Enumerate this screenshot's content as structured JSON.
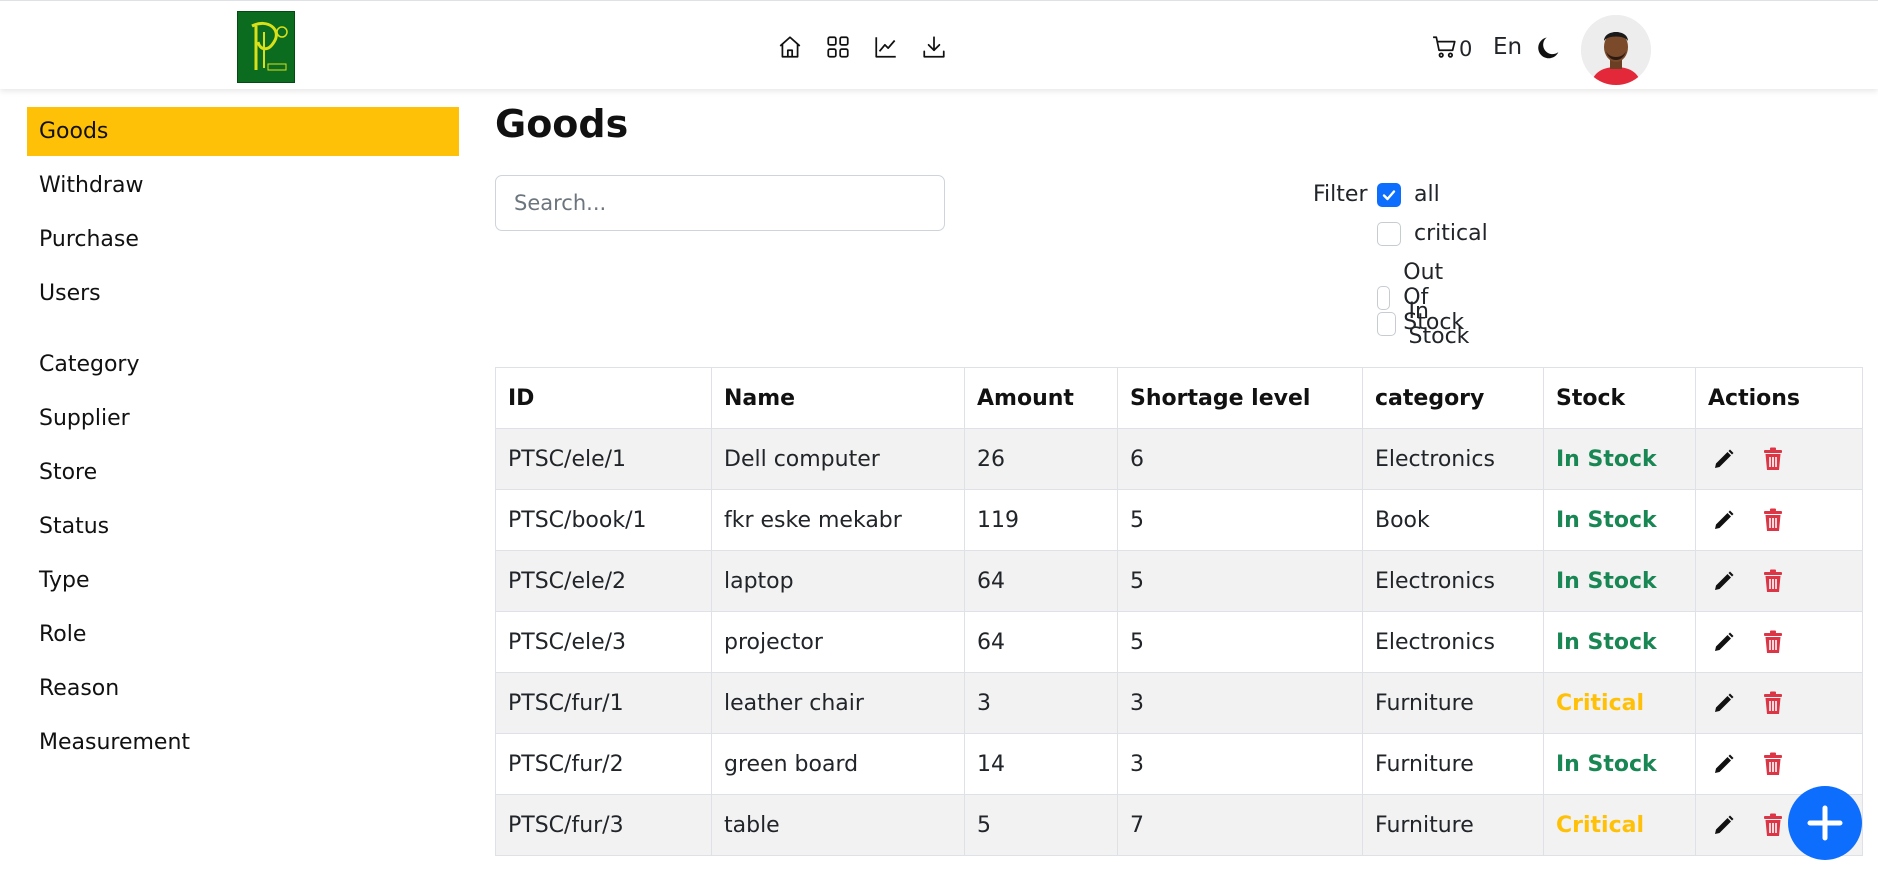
{
  "header": {
    "nav_icons": [
      "home-icon",
      "grid-icon",
      "chart-line-icon",
      "download-icon"
    ],
    "cart_count": "0",
    "language": "En"
  },
  "sidebar": {
    "items": [
      {
        "label": "Goods",
        "active": true
      },
      {
        "label": "Withdraw"
      },
      {
        "label": "Purchase"
      },
      {
        "label": "Users"
      }
    ],
    "items2": [
      {
        "label": "Category"
      },
      {
        "label": "Supplier"
      },
      {
        "label": "Store"
      },
      {
        "label": "Status"
      },
      {
        "label": "Type"
      },
      {
        "label": "Role"
      },
      {
        "label": "Reason"
      },
      {
        "label": "Measurement"
      }
    ]
  },
  "main": {
    "title": "Goods",
    "search_placeholder": "Search...",
    "filter": {
      "label": "Filter",
      "options": [
        {
          "label": "all",
          "checked": true
        },
        {
          "label": "critical",
          "checked": false
        },
        {
          "label": "Out Of Stock",
          "checked": false
        },
        {
          "label": "In Stock",
          "checked": false
        }
      ]
    },
    "table": {
      "columns": [
        "ID",
        "Name",
        "Amount",
        "Shortage level",
        "category",
        "Stock",
        "Actions"
      ],
      "rows": [
        {
          "id": "PTSC/ele/1",
          "name": "Dell computer",
          "amount": "26",
          "shortage": "6",
          "category": "Electronics",
          "stock": "In Stock"
        },
        {
          "id": "PTSC/book/1",
          "name": "fkr eske mekabr",
          "amount": "119",
          "shortage": "5",
          "category": "Book",
          "stock": "In Stock"
        },
        {
          "id": "PTSC/ele/2",
          "name": "laptop",
          "amount": "64",
          "shortage": "5",
          "category": "Electronics",
          "stock": "In Stock"
        },
        {
          "id": "PTSC/ele/3",
          "name": "projector",
          "amount": "64",
          "shortage": "5",
          "category": "Electronics",
          "stock": "In Stock"
        },
        {
          "id": "PTSC/fur/1",
          "name": "leather chair",
          "amount": "3",
          "shortage": "3",
          "category": "Furniture",
          "stock": "Critical"
        },
        {
          "id": "PTSC/fur/2",
          "name": "green board",
          "amount": "14",
          "shortage": "3",
          "category": "Furniture",
          "stock": "In Stock"
        },
        {
          "id": "PTSC/fur/3",
          "name": "table",
          "amount": "5",
          "shortage": "7",
          "category": "Furniture",
          "stock": "Critical"
        }
      ]
    }
  },
  "colors": {
    "accent": "#ffc107",
    "primary": "#0d6efd",
    "in_stock": "#198754",
    "critical": "#ffc107",
    "delete": "#dc3545"
  }
}
